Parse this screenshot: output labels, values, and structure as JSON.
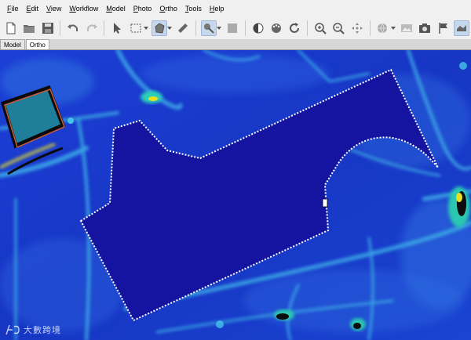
{
  "menu": {
    "items": [
      {
        "label": "File"
      },
      {
        "label": "Edit"
      },
      {
        "label": "View"
      },
      {
        "label": "Workflow"
      },
      {
        "label": "Model"
      },
      {
        "label": "Photo"
      },
      {
        "label": "Ortho"
      },
      {
        "label": "Tools"
      },
      {
        "label": "Help"
      }
    ]
  },
  "tabs": [
    {
      "label": "Model",
      "active": false
    },
    {
      "label": "Ortho",
      "active": true
    }
  ],
  "colors": {
    "polygon_fill": "#1414a0",
    "map_base": "#1a3fd0",
    "highlight": "#25c8c0",
    "hot": "#e0e020"
  },
  "watermark": {
    "text": "大數跨境"
  }
}
